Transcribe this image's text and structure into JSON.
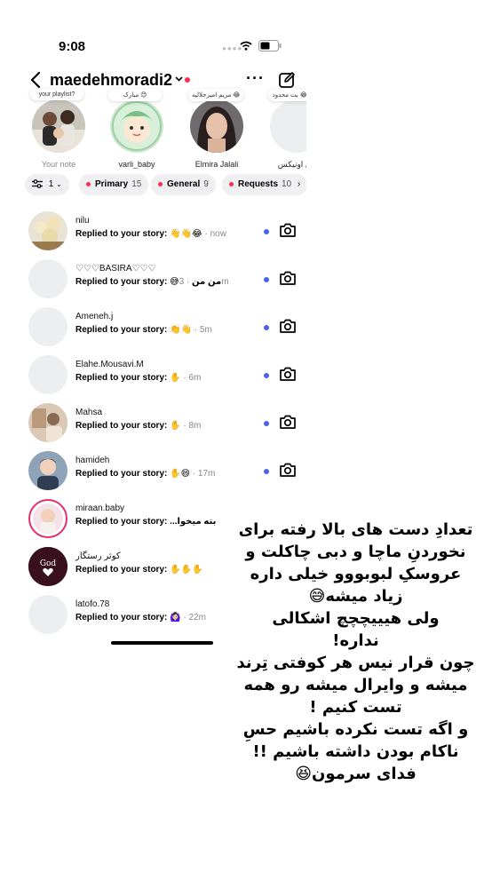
{
  "status": {
    "time": "9:08"
  },
  "header": {
    "username": "maedehmoradi2"
  },
  "notes": [
    {
      "bubble": "your playlist?",
      "name": "Your note",
      "avatar": "family-photo"
    },
    {
      "bubble": "مبارک 😊",
      "name": "varli_baby",
      "avatar": "baby-cartoon"
    },
    {
      "bubble": "مریم امیرجلالیه 😂",
      "name": "Elmira Jalali",
      "avatar": "woman-portrait"
    },
    {
      "bubble": "سد 😂 بت محدود",
      "name": "ری اونیکس",
      "avatar": "blank"
    }
  ],
  "filters": {
    "settings_count": "1",
    "primary_label": "Primary",
    "primary_count": "15",
    "general_label": "General",
    "general_count": "9",
    "requests_label": "Requests",
    "requests_count": "10"
  },
  "rows": [
    {
      "user": "nilu",
      "msg": "Replied to your story: 👋👋😂",
      "time": "· now",
      "unread": true,
      "avatar": "flowers"
    },
    {
      "user": "♡♡♡BASIRA♡♡♡",
      "msg": "Replied to your story: 😅من من",
      "time": "· 3m",
      "unread": true,
      "avatar": "blank"
    },
    {
      "user": "Ameneh.j",
      "msg": "Replied to your story: 👏👋",
      "time": "· 5m",
      "unread": true,
      "avatar": "blank"
    },
    {
      "user": "Elahe.Mousavi.M",
      "msg": "Replied to your story: ✋",
      "time": "· 6m",
      "unread": true,
      "avatar": "blank"
    },
    {
      "user": "Mahsa",
      "msg": "Replied to your story: ✋",
      "time": "· 8m",
      "unread": true,
      "avatar": "photo"
    },
    {
      "user": "hamideh",
      "msg": "Replied to your story: ✋😄",
      "time": "· 17m",
      "unread": true,
      "avatar": "child"
    },
    {
      "user": "miraan.baby",
      "msg": "Replied to your story: ...بته میخوا",
      "time": "",
      "unread": false,
      "avatar": "baby-ring"
    },
    {
      "user": "کوثر رستگار",
      "msg": "Replied to your story: ✋✋✋",
      "time": "",
      "unread": false,
      "avatar": "god-heart"
    },
    {
      "user": "latofo.78",
      "msg": "Replied to your story: 🙆🏻‍♀️",
      "time": "· 22m",
      "unread": false,
      "avatar": "blank"
    }
  ],
  "caption": [
    "تعدادِ دست های بالا رفته برای",
    "نخوردنِ ماچا و دبی چاکلت و",
    "عروسکِ لبوبووو  خیلی داره",
    "زیاد میشه😅",
    "ولی هیییچچچ اشکالی",
    "نداره!",
    "چون قرار نیس هر کوفتی تِرند",
    "میشه و وایرال میشه رو همه",
    "تست کنیم !",
    "و اگه تست نکرده باشیم حسِ",
    "ناکام بودن داشته باشیم !!",
    "فدای سرمون😆"
  ]
}
